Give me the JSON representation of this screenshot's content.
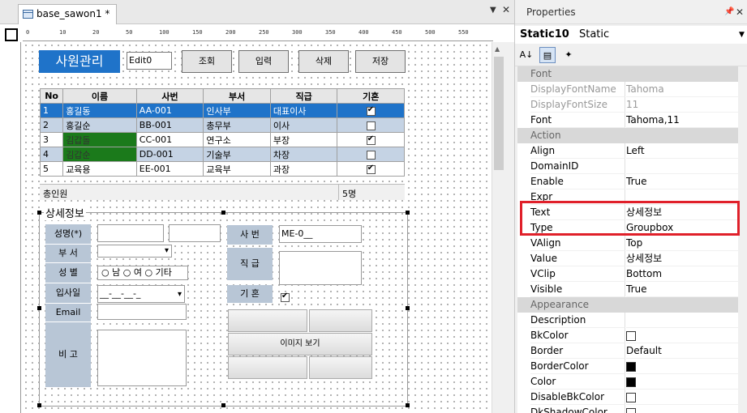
{
  "editor": {
    "tab_label": "base_sawon1 *",
    "ruler_ticks": [
      "0",
      "10",
      "20",
      "50",
      "100",
      "150",
      "200",
      "250",
      "300",
      "350",
      "400",
      "450",
      "500",
      "550"
    ],
    "form": {
      "title_button": "사원관리",
      "edit_field": "Edit0",
      "buttons": [
        "조회",
        "입력",
        "삭제",
        "저장"
      ],
      "grid": {
        "headers": [
          "No",
          "이름",
          "사번",
          "부서",
          "직급",
          "기혼"
        ],
        "rows": [
          {
            "no": "1",
            "name": "홍길동",
            "id": "AA-001",
            "dept": "인사부",
            "rank": "대표이사",
            "married": true
          },
          {
            "no": "2",
            "name": "홍길순",
            "id": "BB-001",
            "dept": "총무부",
            "rank": "이사",
            "married": false
          },
          {
            "no": "3",
            "name": "김갑돌",
            "id": "CC-001",
            "dept": "연구소",
            "rank": "부장",
            "married": true
          },
          {
            "no": "4",
            "name": "김갑순",
            "id": "DD-001",
            "dept": "기술부",
            "rank": "차장",
            "married": false
          },
          {
            "no": "5",
            "name": "교육용",
            "id": "EE-001",
            "dept": "교육부",
            "rank": "과장",
            "married": true
          }
        ],
        "summary_label": "총인원",
        "summary_value": "5명"
      },
      "groupbox_label": "상세정보",
      "labels": {
        "name": "성명(*)",
        "dept": "부 서",
        "gender": "성 별",
        "joined": "입사일",
        "email": "Email",
        "note": "비 고",
        "emp_no": "사 번",
        "rank": "직 급",
        "married": "기 혼"
      },
      "gender_options": [
        "남",
        "여",
        "기타"
      ],
      "joined_value": "__-__-__-_",
      "emp_no_value": "ME-0__",
      "image_button": "이미지 보기"
    }
  },
  "properties": {
    "panel_title": "Properties",
    "object_name": "Static10",
    "object_type": "Static",
    "rows": [
      {
        "kind": "category",
        "name": "Font"
      },
      {
        "kind": "prop",
        "name": "DisplayFontName",
        "value": "Tahoma",
        "dim": true
      },
      {
        "kind": "prop",
        "name": "DisplayFontSize",
        "value": "11",
        "dim": true
      },
      {
        "kind": "prop",
        "name": "Font",
        "value": "Tahoma,11"
      },
      {
        "kind": "category",
        "name": "Action"
      },
      {
        "kind": "prop",
        "name": "Align",
        "value": "Left"
      },
      {
        "kind": "prop",
        "name": "DomainID",
        "value": ""
      },
      {
        "kind": "prop",
        "name": "Enable",
        "value": "True"
      },
      {
        "kind": "prop",
        "name": "Expr",
        "value": ""
      },
      {
        "kind": "prop",
        "name": "Text",
        "value": "상세정보"
      },
      {
        "kind": "prop",
        "name": "Type",
        "value": "Groupbox"
      },
      {
        "kind": "prop",
        "name": "VAlign",
        "value": "Top"
      },
      {
        "kind": "prop",
        "name": "Value",
        "value": "상세정보"
      },
      {
        "kind": "prop",
        "name": "VClip",
        "value": "Bottom"
      },
      {
        "kind": "prop",
        "name": "Visible",
        "value": "True"
      },
      {
        "kind": "category",
        "name": "Appearance"
      },
      {
        "kind": "prop",
        "name": "Description",
        "value": ""
      },
      {
        "kind": "prop",
        "name": "BkColor",
        "value": "",
        "swatch": "#ffffff"
      },
      {
        "kind": "prop",
        "name": "Border",
        "value": "Default"
      },
      {
        "kind": "prop",
        "name": "BorderColor",
        "value": "",
        "swatch": "#000000"
      },
      {
        "kind": "prop",
        "name": "Color",
        "value": "",
        "swatch": "#000000"
      },
      {
        "kind": "prop",
        "name": "DisableBkColor",
        "value": "",
        "swatch": "#ffffff"
      },
      {
        "kind": "prop",
        "name": "DkShadowColor",
        "value": "",
        "swatch": "#ffffff"
      }
    ]
  },
  "colors": {
    "accent": "#1f73c9",
    "highlight": "#e0202a",
    "grid_alt": "#c5d3e4",
    "green_cell": "#1b7a1b"
  }
}
